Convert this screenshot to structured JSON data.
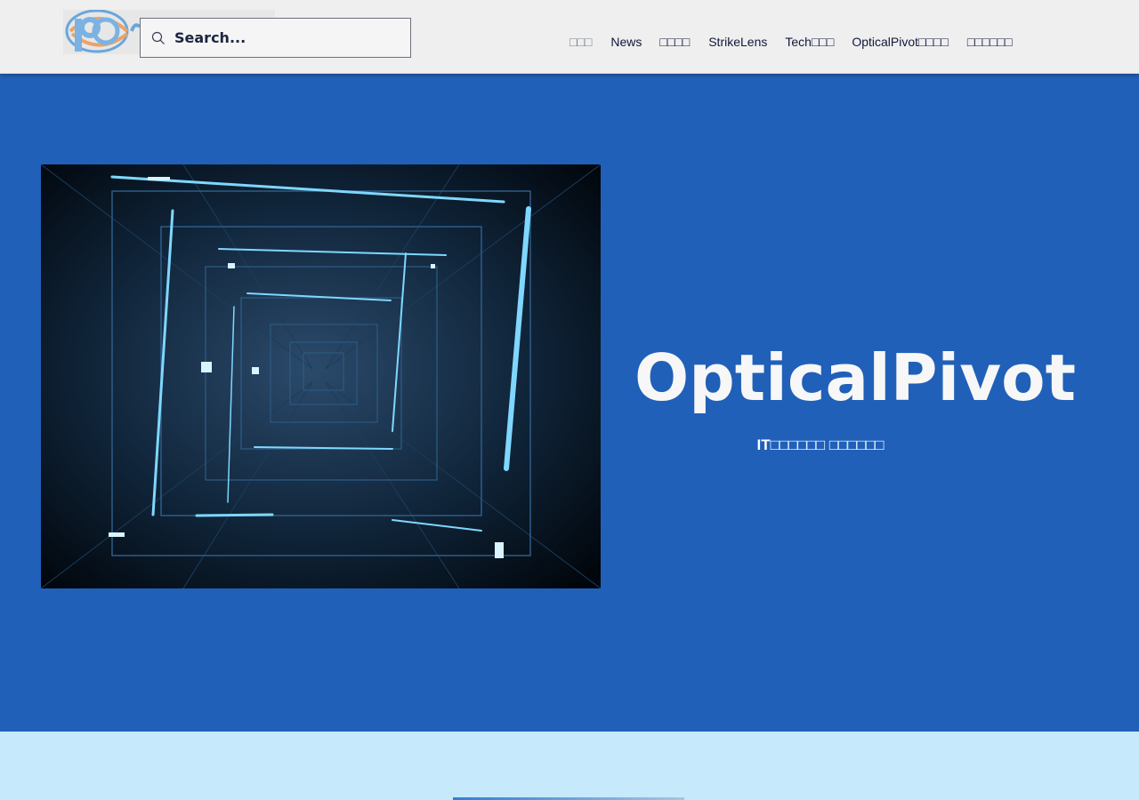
{
  "header": {
    "logo_icon": "op-eye-logo",
    "search": {
      "placeholder": "Search...",
      "value": "",
      "icon": "search-icon"
    },
    "nav": [
      {
        "label": "□□□",
        "color": "#7a7f91"
      },
      {
        "label": "News",
        "color": "#10173a"
      },
      {
        "label": "□□□□",
        "color": "#10173a"
      },
      {
        "label": "StrikeLens",
        "color": "#10173a"
      },
      {
        "label": "Tech□□□",
        "color": "#10173a"
      },
      {
        "label": "OpticalPivot□□□□",
        "color": "#10173a"
      },
      {
        "label": "□□□□□□",
        "color": "#10173a"
      }
    ]
  },
  "hero": {
    "title": "OpticalPivot",
    "subtitle": "IT□□□□□□ □□□□□□",
    "background": "#2060b8",
    "image": "digital-tunnel-image"
  },
  "colors": {
    "header_bg": "#efefef",
    "hero_bg": "#2060b8",
    "page_bg": "#c6e9fb",
    "accent": "#2f7fd6"
  }
}
